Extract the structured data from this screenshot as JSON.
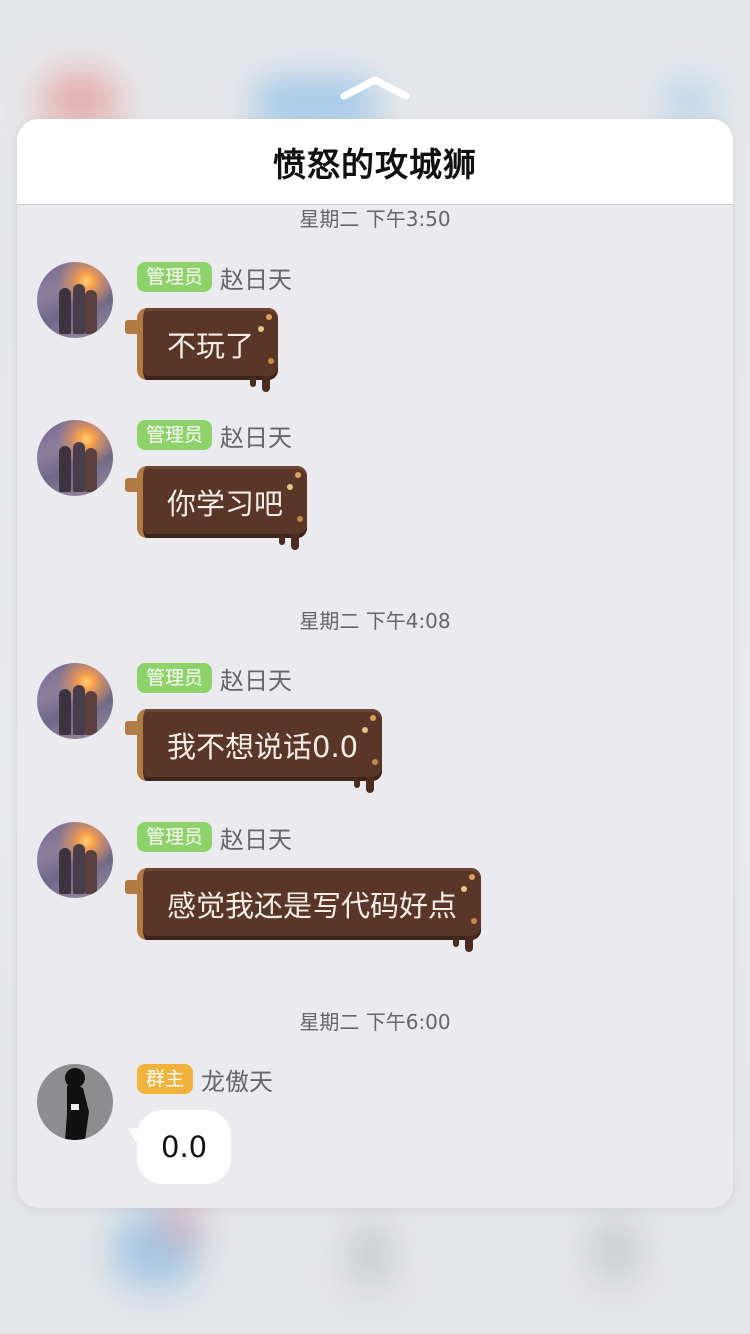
{
  "header": {
    "title": "愤怒的攻城狮"
  },
  "timestamps": [
    "星期二 下午3:50",
    "星期二 下午4:08",
    "星期二 下午6:00"
  ],
  "messages": [
    {
      "badge": "管理员",
      "sender": "赵日天",
      "text": "不玩了"
    },
    {
      "badge": "管理员",
      "sender": "赵日天",
      "text": "你学习吧"
    },
    {
      "badge": "管理员",
      "sender": "赵日天",
      "text": "我不想说话0.0"
    },
    {
      "badge": "管理员",
      "sender": "赵日天",
      "text": "感觉我还是写代码好点"
    },
    {
      "badge": "群主",
      "sender": "龙傲天",
      "text": "0.0"
    }
  ],
  "colors": {
    "admin_badge": "#8ed36a",
    "owner_badge": "#f1b33b",
    "chocolate_bubble": "#5a3628",
    "card_bg": "#ebebef"
  },
  "icons": {
    "chevron": "chevron-up-icon"
  }
}
